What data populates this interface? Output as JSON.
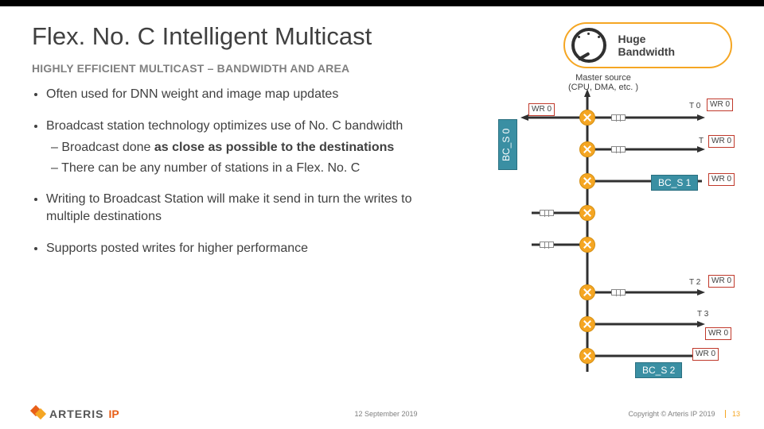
{
  "title": "Flex. No. C Intelligent Multicast",
  "subtitle": "HIGHLY EFFICIENT MULTICAST – BANDWIDTH AND AREA",
  "badge": {
    "line1": "Huge",
    "line2": "Bandwidth"
  },
  "bullets": [
    {
      "text": "Often used for DNN weight and image map updates"
    },
    {
      "text": "Broadcast station technology optimizes use of No. C bandwidth",
      "subs": [
        {
          "pre": "Broadcast done ",
          "bold": "as close as possible to the destinations",
          "post": ""
        },
        {
          "pre": "There can be any number of stations in a Flex. No. C",
          "bold": "",
          "post": ""
        }
      ]
    },
    {
      "text": "Writing to Broadcast Station will make it send in turn the writes to multiple destinations"
    },
    {
      "text": "Supports posted writes for higher performance"
    }
  ],
  "diagram": {
    "master_source": "Master source\n(CPU, DMA, etc. )",
    "bc_s0": "BC_S 0",
    "bc_s1": "BC_S 1",
    "bc_s2": "BC_S 2",
    "wr0": "WR\n0",
    "t0": "T 0",
    "t1": "T",
    "t2": "T 2",
    "t3": "T 3"
  },
  "footer": {
    "date": "12 September 2019",
    "copyright": "Copyright © Arteris IP 2019",
    "page": "13",
    "logo_text": "ARTERIS",
    "logo_ip": "IP"
  }
}
